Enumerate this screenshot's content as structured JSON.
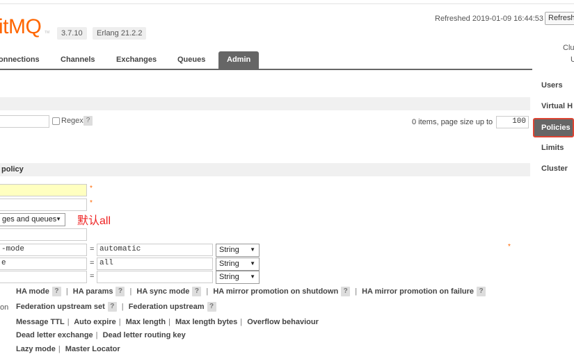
{
  "header": {
    "logo_main": "itMQ",
    "logo_tm": "TM",
    "version": "3.7.10",
    "erlang": "Erlang 21.2.2",
    "refreshed": "Refreshed 2019-01-09 16:44:53",
    "refresh_button": "Refresh",
    "cluster_label": "Clu",
    "user_label": "U"
  },
  "tabs": [
    {
      "label": "onnections"
    },
    {
      "label": "Channels"
    },
    {
      "label": "Exchanges"
    },
    {
      "label": "Queues"
    },
    {
      "label": "Admin",
      "active": true
    }
  ],
  "sidebar": {
    "items": [
      "Users",
      "Virtual H",
      "Policies",
      "Limits",
      "Cluster"
    ],
    "active": "Policies"
  },
  "filter": {
    "regex_label": "Regex",
    "help": "?",
    "items_text": "0 items, page size up to",
    "page_size": "100"
  },
  "add_policy": {
    "title": "policy",
    "star": "*",
    "apply_to": "ges and queues",
    "annotation": "默认all",
    "definitions": [
      {
        "key": "-mode",
        "value": "automatic",
        "type": "String"
      },
      {
        "key": "e",
        "value": "all",
        "type": "String"
      },
      {
        "key": "",
        "value": "",
        "type": "String"
      }
    ],
    "equals": "="
  },
  "options": {
    "row1": [
      "HA mode",
      "HA params",
      "HA sync mode",
      "HA mirror promotion on shutdown",
      "HA mirror promotion on failure"
    ],
    "row2_label": "on",
    "row2": [
      "Federation upstream set",
      "Federation upstream"
    ],
    "row3": [
      "Message TTL",
      "Auto expire",
      "Max length",
      "Max length bytes",
      "Overflow behaviour"
    ],
    "row4": [
      "Dead letter exchange",
      "Dead letter routing key"
    ],
    "row5": [
      "Lazy mode",
      "Master Locator"
    ],
    "separator": "|"
  },
  "colors": {
    "accent": "#ff6600",
    "tab_active": "#666666",
    "highlight_border": "#dd4433"
  }
}
